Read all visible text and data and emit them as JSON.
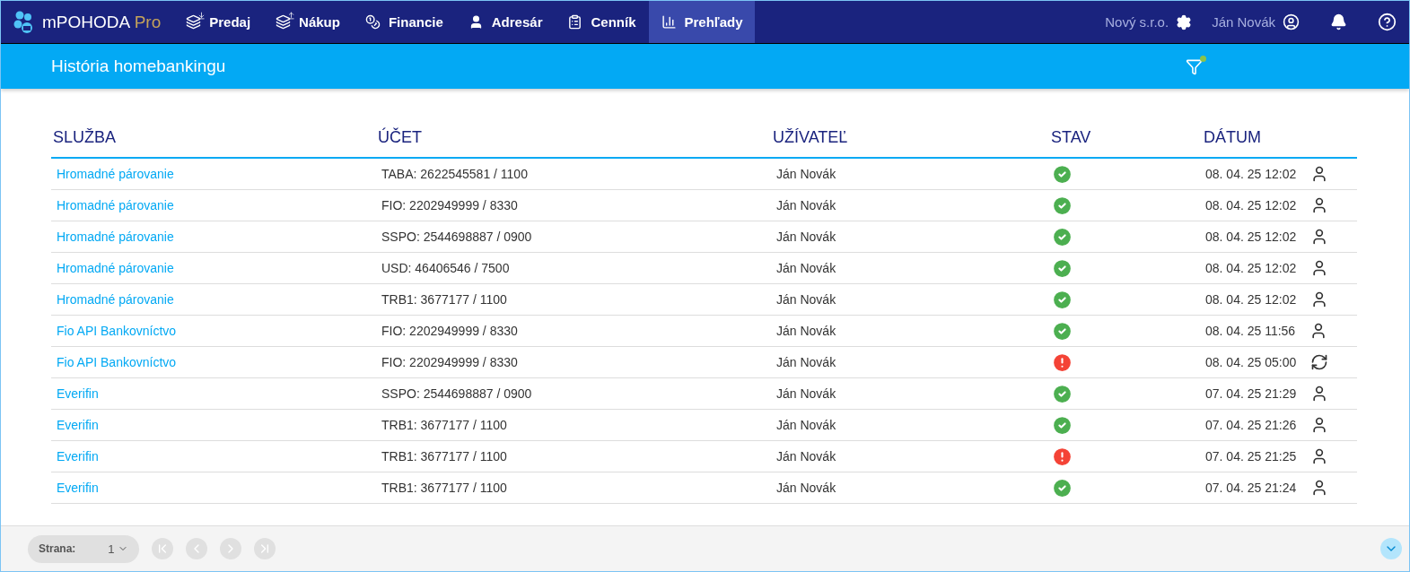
{
  "app": {
    "brand": "mPOHODA",
    "edition": "Pro"
  },
  "nav": [
    {
      "label": "Predaj",
      "selected": false
    },
    {
      "label": "Nákup",
      "selected": false
    },
    {
      "label": "Financie",
      "selected": false
    },
    {
      "label": "Adresár",
      "selected": false
    },
    {
      "label": "Cenník",
      "selected": false
    },
    {
      "label": "Prehľady",
      "selected": true
    }
  ],
  "account": {
    "company": "Nový s.r.o.",
    "user": "Ján Novák"
  },
  "page": {
    "title": "História homebankingu",
    "filter_active": true
  },
  "table": {
    "columns": [
      "SLUŽBA",
      "ÚČET",
      "UŽÍVATEĽ",
      "STAV",
      "DÁTUM"
    ],
    "rows": [
      {
        "service": "Hromadné párovanie",
        "account": "TABA: 2622545581 / 1100",
        "user": "Ján Novák",
        "status": {
          "kind": "ok"
        },
        "date": "08. 04. 25 12:02",
        "source": {
          "kind": "user"
        }
      },
      {
        "service": "Hromadné párovanie",
        "account": "FIO: 2202949999 / 8330",
        "user": "Ján Novák",
        "status": {
          "kind": "ok"
        },
        "date": "08. 04. 25 12:02",
        "source": {
          "kind": "user"
        }
      },
      {
        "service": "Hromadné párovanie",
        "account": "SSPO: 2544698887 / 0900",
        "user": "Ján Novák",
        "status": {
          "kind": "ok"
        },
        "date": "08. 04. 25 12:02",
        "source": {
          "kind": "user"
        }
      },
      {
        "service": "Hromadné párovanie",
        "account": "USD: 46406546 / 7500",
        "user": "Ján Novák",
        "status": {
          "kind": "ok"
        },
        "date": "08. 04. 25 12:02",
        "source": {
          "kind": "user"
        }
      },
      {
        "service": "Hromadné párovanie",
        "account": "TRB1: 3677177 / 1100",
        "user": "Ján Novák",
        "status": {
          "kind": "ok"
        },
        "date": "08. 04. 25 12:02",
        "source": {
          "kind": "user"
        }
      },
      {
        "service": "Fio API Bankovníctvo",
        "account": "FIO: 2202949999 / 8330",
        "user": "Ján Novák",
        "status": {
          "kind": "ok"
        },
        "date": "08. 04. 25 11:56",
        "source": {
          "kind": "user"
        }
      },
      {
        "service": "Fio API Bankovníctvo",
        "account": "FIO: 2202949999 / 8330",
        "user": "Ján Novák",
        "status": {
          "kind": "error"
        },
        "date": "08. 04. 25 05:00",
        "source": {
          "kind": "auto"
        }
      },
      {
        "service": "Everifin",
        "account": "SSPO: 2544698887 / 0900",
        "user": "Ján Novák",
        "status": {
          "kind": "ok"
        },
        "date": "07. 04. 25 21:29",
        "source": {
          "kind": "user"
        }
      },
      {
        "service": "Everifin",
        "account": "TRB1: 3677177 / 1100",
        "user": "Ján Novák",
        "status": {
          "kind": "ok"
        },
        "date": "07. 04. 25 21:26",
        "source": {
          "kind": "user"
        }
      },
      {
        "service": "Everifin",
        "account": "TRB1: 3677177 / 1100",
        "user": "Ján Novák",
        "status": {
          "kind": "error"
        },
        "date": "07. 04. 25 21:25",
        "source": {
          "kind": "user"
        }
      },
      {
        "service": "Everifin",
        "account": "TRB1: 3677177 / 1100",
        "user": "Ján Novák",
        "status": {
          "kind": "ok"
        },
        "date": "07. 04. 25 21:24",
        "source": {
          "kind": "user"
        }
      }
    ]
  },
  "pager": {
    "label": "Strana:",
    "page": "1",
    "first_disabled": true,
    "prev_disabled": true,
    "next_disabled": true,
    "last_disabled": true
  }
}
